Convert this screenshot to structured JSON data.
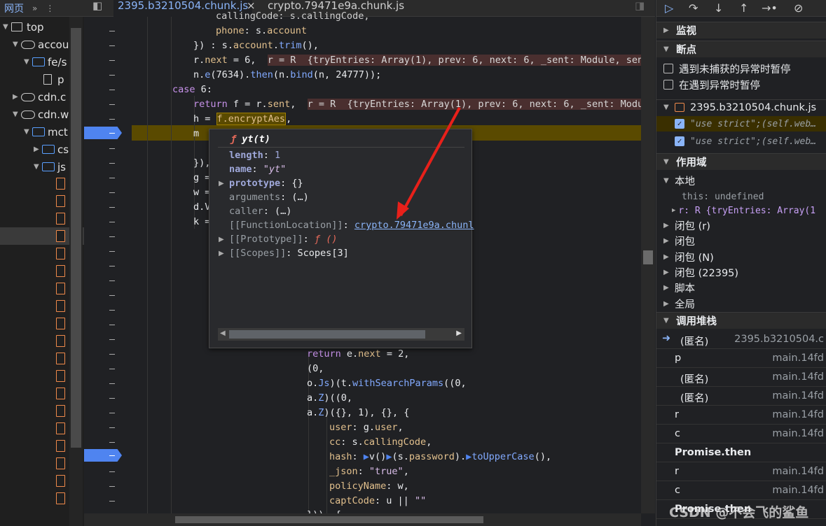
{
  "left_panel": {
    "tab_label": "网页",
    "more_label": "»",
    "tree": [
      {
        "label": "top",
        "icon": "page-frame-icon"
      },
      {
        "label": "accou",
        "icon": "cloud-icon"
      },
      {
        "label": "fe/s",
        "icon": "folder-icon"
      },
      {
        "label": "p",
        "icon": "page-icon"
      },
      {
        "label": "cdn.c",
        "icon": "cloud-icon"
      },
      {
        "label": "cdn.w",
        "icon": "cloud-icon"
      },
      {
        "label": "mct",
        "icon": "folder-icon"
      },
      {
        "label": "cs",
        "icon": "folder-icon"
      },
      {
        "label": "js",
        "icon": "folder-icon"
      }
    ]
  },
  "editor": {
    "tabs": [
      {
        "label": "2395.b3210504.chunk.js",
        "active": true
      },
      {
        "label": "crypto.79471e9a.chunk.js",
        "active": false
      }
    ],
    "close_glyph": "×",
    "lines": [
      {
        "t": "callingCode: s.callingCode,"
      },
      {
        "t": "phone: s.account"
      },
      {
        "t": "}) : s.account.trim(),"
      },
      {
        "t": "r.next = 6,"
      },
      {
        "t": "n.e(7634).then(n.bind(n, 24777));"
      },
      {
        "t": "case 6:"
      },
      {
        "t": "return f = r.sent,"
      },
      {
        "t": "h = f.encryptAes,"
      },
      {
        "t": "m"
      },
      {
        "t": "}),"
      },
      {
        "t": "g ="
      },
      {
        "t": "w ="
      },
      {
        "t": "d.V"
      },
      {
        "t": "k ="
      },
      {
        "t": "return e.next = 2,"
      },
      {
        "t": "(0,"
      },
      {
        "t": "o.Js)(t.withSearchParams((0,"
      },
      {
        "t": "a.Z)((0,"
      },
      {
        "t": "a.Z)({}, 1), {}, {"
      },
      {
        "t": "user: g.user,"
      },
      {
        "t": "cc: s.callingCode,"
      },
      {
        "t": "hash: ▶v()▶(s.password).▶toUpperCase(),"
      },
      {
        "t": "_json: \"true\","
      },
      {
        "t": "policyName: w,"
      },
      {
        "t": "captCode: u || \"\""
      },
      {
        "t": "})), {"
      }
    ],
    "inline_values": {
      "next": "r = R  {tryEntries: Array(1), prev: 6, next: 6, _sent: Module, sent",
      "sent": "r = R  {tryEntries: Array(1), prev: 6, next: 6, _sent: Modul"
    }
  },
  "popover": {
    "title_prefix": "ƒ",
    "title": "yt(t)",
    "rows": [
      {
        "key": "length",
        "value": "1"
      },
      {
        "key": "name",
        "value": "\"yt\""
      },
      {
        "key": "prototype",
        "value": "{}"
      },
      {
        "key": "arguments",
        "value": "(…)"
      },
      {
        "key": "caller",
        "value": "(…)"
      },
      {
        "key": "[[FunctionLocation]]",
        "value": "crypto.79471e9a.chunl"
      },
      {
        "key": "[[Prototype]]",
        "value": "ƒ ()"
      },
      {
        "key": "[[Scopes]]",
        "value": "Scopes[3]"
      }
    ]
  },
  "right_panel": {
    "sections": {
      "watch": "监视",
      "breakpoints": "断点",
      "scope": "作用域",
      "callstack": "调用堆栈"
    },
    "pause_uncaught": "遇到未捕获的异常时暂停",
    "pause_caught": "在遇到异常时暂停",
    "bp_file": "2395.b3210504.chunk.js",
    "bp_items": [
      "\"use strict\";(self.web…",
      "\"use strict\";(self.web…"
    ],
    "scope_local": "本地",
    "this_row": "this: undefined",
    "r_row": "r: R  {tryEntries: Array(1",
    "closures": [
      "闭包 (r)",
      "闭包",
      "闭包 (N)",
      "闭包 (22395)",
      "脚本",
      "全局"
    ],
    "stack": [
      {
        "name": "(匿名)",
        "file": "2395.b3210504.c",
        "current": true
      },
      {
        "name": "p",
        "file": "main.14fd"
      },
      {
        "name": "(匿名)",
        "file": "main.14fd"
      },
      {
        "name": "(匿名)",
        "file": "main.14fd"
      },
      {
        "name": "r",
        "file": "main.14fd"
      },
      {
        "name": "c",
        "file": "main.14fd"
      },
      {
        "name": "Promise.then",
        "file": "",
        "async": true
      },
      {
        "name": "r",
        "file": "main.14fd"
      },
      {
        "name": "c",
        "file": "main.14fd"
      },
      {
        "name": "Promise.then",
        "file": "",
        "async": true
      }
    ]
  },
  "watermark": "CSDN @不会飞的鲨鱼",
  "colors": {
    "breakpoint": "#4f84f0",
    "highlight": "#5a4a00",
    "arrow": "#e8201a",
    "accent": "#8ab4f8"
  }
}
